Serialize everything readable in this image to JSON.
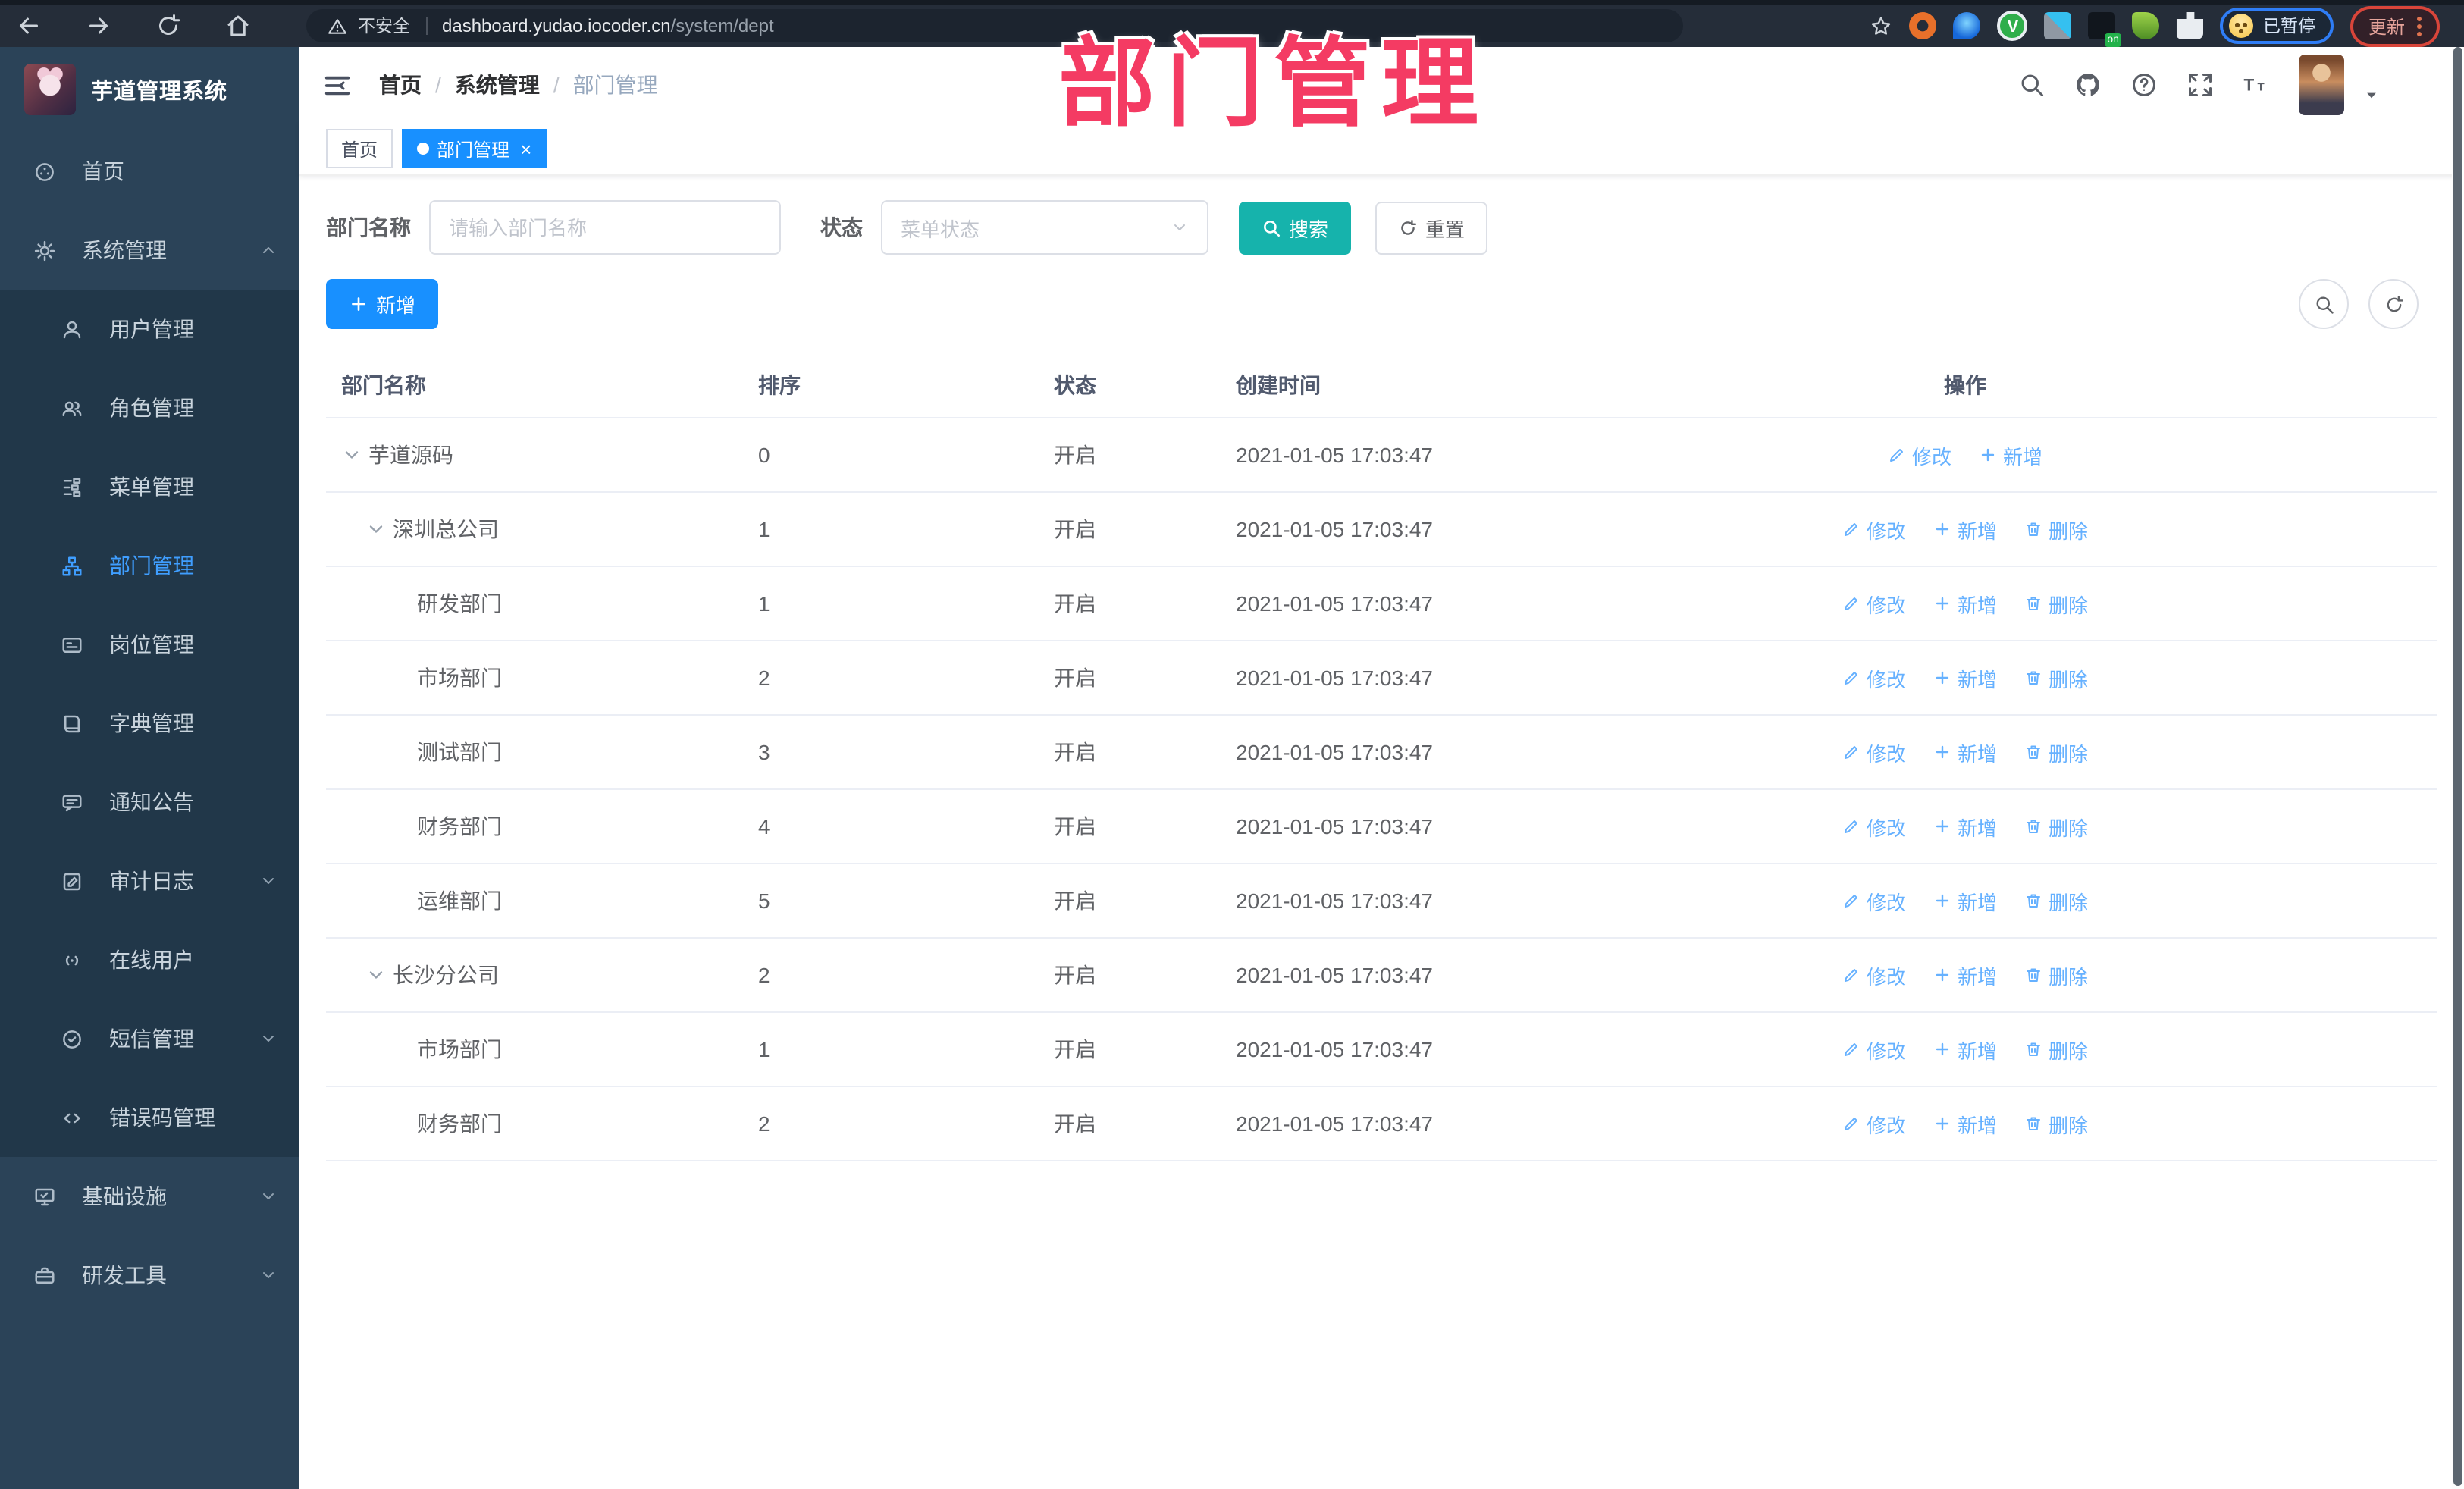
{
  "browser": {
    "insecure_label": "不安全",
    "url_host": "dashboard.yudao.iocoder.cn",
    "url_path": "/system/dept",
    "paused_label": "已暂停",
    "update_label": "更新"
  },
  "watermark": "部门管理",
  "sidebar": {
    "title": "芋道管理系统",
    "items": [
      {
        "label": "首页",
        "icon": "dashboard-icon",
        "kind": "root"
      },
      {
        "label": "系统管理",
        "icon": "gear-icon",
        "kind": "root",
        "arrow": "up"
      },
      {
        "label": "用户管理",
        "icon": "user-icon",
        "kind": "sub"
      },
      {
        "label": "角色管理",
        "icon": "users-icon",
        "kind": "sub"
      },
      {
        "label": "菜单管理",
        "icon": "menu-tree-icon",
        "kind": "sub"
      },
      {
        "label": "部门管理",
        "icon": "org-chart-icon",
        "kind": "sub",
        "active": true
      },
      {
        "label": "岗位管理",
        "icon": "id-card-icon",
        "kind": "sub"
      },
      {
        "label": "字典管理",
        "icon": "dictionary-icon",
        "kind": "sub"
      },
      {
        "label": "通知公告",
        "icon": "announcement-icon",
        "kind": "sub"
      },
      {
        "label": "审计日志",
        "icon": "audit-log-icon",
        "kind": "sub",
        "arrow": "down"
      },
      {
        "label": "在线用户",
        "icon": "online-user-icon",
        "kind": "sub"
      },
      {
        "label": "短信管理",
        "icon": "sms-icon",
        "kind": "sub",
        "arrow": "down"
      },
      {
        "label": "错误码管理",
        "icon": "code-icon",
        "kind": "sub"
      },
      {
        "label": "基础设施",
        "icon": "infrastructure-icon",
        "kind": "root",
        "arrow": "down"
      },
      {
        "label": "研发工具",
        "icon": "toolbox-icon",
        "kind": "root",
        "arrow": "down"
      }
    ]
  },
  "header": {
    "breadcrumb": [
      "首页",
      "系统管理",
      "部门管理"
    ]
  },
  "tags": [
    {
      "label": "首页",
      "active": false,
      "closable": false
    },
    {
      "label": "部门管理",
      "active": true,
      "closable": true
    }
  ],
  "filter": {
    "name_label": "部门名称",
    "name_placeholder": "请输入部门名称",
    "status_label": "状态",
    "status_placeholder": "菜单状态",
    "search_label": "搜索",
    "reset_label": "重置"
  },
  "toolbar": {
    "add_label": "新增"
  },
  "table": {
    "headers": [
      "部门名称",
      "排序",
      "状态",
      "创建时间",
      "操作"
    ],
    "action_labels": {
      "edit": "修改",
      "add": "新增",
      "delete": "删除"
    },
    "rows": [
      {
        "name": "芋道源码",
        "depth": 0,
        "expandable": true,
        "sort": "0",
        "status": "开启",
        "time": "2021-01-05 17:03:47",
        "actions": [
          "edit",
          "add"
        ]
      },
      {
        "name": "深圳总公司",
        "depth": 1,
        "expandable": true,
        "sort": "1",
        "status": "开启",
        "time": "2021-01-05 17:03:47",
        "actions": [
          "edit",
          "add",
          "delete"
        ]
      },
      {
        "name": "研发部门",
        "depth": 2,
        "expandable": false,
        "sort": "1",
        "status": "开启",
        "time": "2021-01-05 17:03:47",
        "actions": [
          "edit",
          "add",
          "delete"
        ]
      },
      {
        "name": "市场部门",
        "depth": 2,
        "expandable": false,
        "sort": "2",
        "status": "开启",
        "time": "2021-01-05 17:03:47",
        "actions": [
          "edit",
          "add",
          "delete"
        ]
      },
      {
        "name": "测试部门",
        "depth": 2,
        "expandable": false,
        "sort": "3",
        "status": "开启",
        "time": "2021-01-05 17:03:47",
        "actions": [
          "edit",
          "add",
          "delete"
        ]
      },
      {
        "name": "财务部门",
        "depth": 2,
        "expandable": false,
        "sort": "4",
        "status": "开启",
        "time": "2021-01-05 17:03:47",
        "actions": [
          "edit",
          "add",
          "delete"
        ]
      },
      {
        "name": "运维部门",
        "depth": 2,
        "expandable": false,
        "sort": "5",
        "status": "开启",
        "time": "2021-01-05 17:03:47",
        "actions": [
          "edit",
          "add",
          "delete"
        ]
      },
      {
        "name": "长沙分公司",
        "depth": 1,
        "expandable": true,
        "sort": "2",
        "status": "开启",
        "time": "2021-01-05 17:03:47",
        "actions": [
          "edit",
          "add",
          "delete"
        ]
      },
      {
        "name": "市场部门",
        "depth": 2,
        "expandable": false,
        "sort": "1",
        "status": "开启",
        "time": "2021-01-05 17:03:47",
        "actions": [
          "edit",
          "add",
          "delete"
        ]
      },
      {
        "name": "财务部门",
        "depth": 2,
        "expandable": false,
        "sort": "2",
        "status": "开启",
        "time": "2021-01-05 17:03:47",
        "actions": [
          "edit",
          "add",
          "delete"
        ]
      }
    ]
  },
  "colors": {
    "accent_blue": "#1890ff",
    "search_teal": "#16b3ac",
    "watermark_pink": "#f43b63",
    "sidebar_bg": "#2b4358",
    "sidebar_sub_bg": "#213749",
    "action_link": "#66b1ff"
  }
}
